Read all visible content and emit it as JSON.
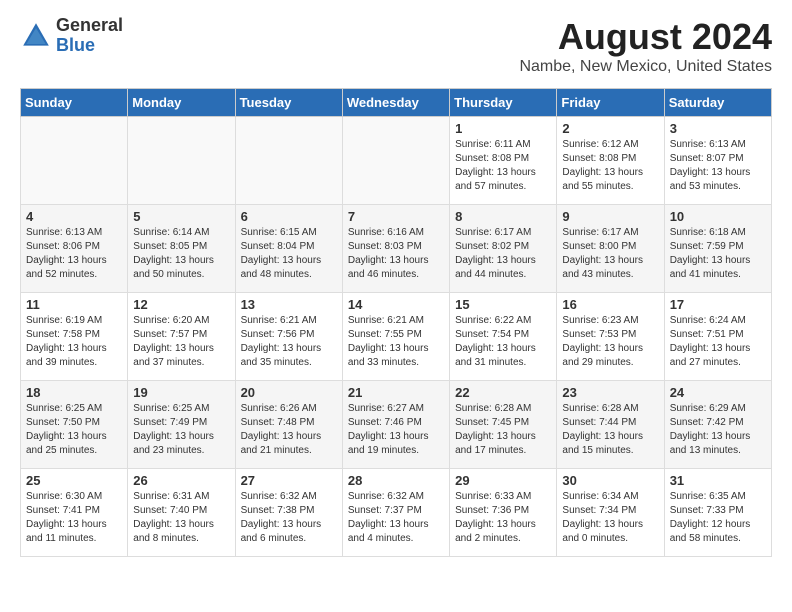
{
  "header": {
    "logo": {
      "general": "General",
      "blue": "Blue"
    },
    "title": "August 2024",
    "subtitle": "Nambe, New Mexico, United States"
  },
  "calendar": {
    "weekdays": [
      "Sunday",
      "Monday",
      "Tuesday",
      "Wednesday",
      "Thursday",
      "Friday",
      "Saturday"
    ],
    "weeks": [
      [
        {
          "day": "",
          "info": ""
        },
        {
          "day": "",
          "info": ""
        },
        {
          "day": "",
          "info": ""
        },
        {
          "day": "",
          "info": ""
        },
        {
          "day": "1",
          "info": "Sunrise: 6:11 AM\nSunset: 8:08 PM\nDaylight: 13 hours\nand 57 minutes."
        },
        {
          "day": "2",
          "info": "Sunrise: 6:12 AM\nSunset: 8:08 PM\nDaylight: 13 hours\nand 55 minutes."
        },
        {
          "day": "3",
          "info": "Sunrise: 6:13 AM\nSunset: 8:07 PM\nDaylight: 13 hours\nand 53 minutes."
        }
      ],
      [
        {
          "day": "4",
          "info": "Sunrise: 6:13 AM\nSunset: 8:06 PM\nDaylight: 13 hours\nand 52 minutes."
        },
        {
          "day": "5",
          "info": "Sunrise: 6:14 AM\nSunset: 8:05 PM\nDaylight: 13 hours\nand 50 minutes."
        },
        {
          "day": "6",
          "info": "Sunrise: 6:15 AM\nSunset: 8:04 PM\nDaylight: 13 hours\nand 48 minutes."
        },
        {
          "day": "7",
          "info": "Sunrise: 6:16 AM\nSunset: 8:03 PM\nDaylight: 13 hours\nand 46 minutes."
        },
        {
          "day": "8",
          "info": "Sunrise: 6:17 AM\nSunset: 8:02 PM\nDaylight: 13 hours\nand 44 minutes."
        },
        {
          "day": "9",
          "info": "Sunrise: 6:17 AM\nSunset: 8:00 PM\nDaylight: 13 hours\nand 43 minutes."
        },
        {
          "day": "10",
          "info": "Sunrise: 6:18 AM\nSunset: 7:59 PM\nDaylight: 13 hours\nand 41 minutes."
        }
      ],
      [
        {
          "day": "11",
          "info": "Sunrise: 6:19 AM\nSunset: 7:58 PM\nDaylight: 13 hours\nand 39 minutes."
        },
        {
          "day": "12",
          "info": "Sunrise: 6:20 AM\nSunset: 7:57 PM\nDaylight: 13 hours\nand 37 minutes."
        },
        {
          "day": "13",
          "info": "Sunrise: 6:21 AM\nSunset: 7:56 PM\nDaylight: 13 hours\nand 35 minutes."
        },
        {
          "day": "14",
          "info": "Sunrise: 6:21 AM\nSunset: 7:55 PM\nDaylight: 13 hours\nand 33 minutes."
        },
        {
          "day": "15",
          "info": "Sunrise: 6:22 AM\nSunset: 7:54 PM\nDaylight: 13 hours\nand 31 minutes."
        },
        {
          "day": "16",
          "info": "Sunrise: 6:23 AM\nSunset: 7:53 PM\nDaylight: 13 hours\nand 29 minutes."
        },
        {
          "day": "17",
          "info": "Sunrise: 6:24 AM\nSunset: 7:51 PM\nDaylight: 13 hours\nand 27 minutes."
        }
      ],
      [
        {
          "day": "18",
          "info": "Sunrise: 6:25 AM\nSunset: 7:50 PM\nDaylight: 13 hours\nand 25 minutes."
        },
        {
          "day": "19",
          "info": "Sunrise: 6:25 AM\nSunset: 7:49 PM\nDaylight: 13 hours\nand 23 minutes."
        },
        {
          "day": "20",
          "info": "Sunrise: 6:26 AM\nSunset: 7:48 PM\nDaylight: 13 hours\nand 21 minutes."
        },
        {
          "day": "21",
          "info": "Sunrise: 6:27 AM\nSunset: 7:46 PM\nDaylight: 13 hours\nand 19 minutes."
        },
        {
          "day": "22",
          "info": "Sunrise: 6:28 AM\nSunset: 7:45 PM\nDaylight: 13 hours\nand 17 minutes."
        },
        {
          "day": "23",
          "info": "Sunrise: 6:28 AM\nSunset: 7:44 PM\nDaylight: 13 hours\nand 15 minutes."
        },
        {
          "day": "24",
          "info": "Sunrise: 6:29 AM\nSunset: 7:42 PM\nDaylight: 13 hours\nand 13 minutes."
        }
      ],
      [
        {
          "day": "25",
          "info": "Sunrise: 6:30 AM\nSunset: 7:41 PM\nDaylight: 13 hours\nand 11 minutes."
        },
        {
          "day": "26",
          "info": "Sunrise: 6:31 AM\nSunset: 7:40 PM\nDaylight: 13 hours\nand 8 minutes."
        },
        {
          "day": "27",
          "info": "Sunrise: 6:32 AM\nSunset: 7:38 PM\nDaylight: 13 hours\nand 6 minutes."
        },
        {
          "day": "28",
          "info": "Sunrise: 6:32 AM\nSunset: 7:37 PM\nDaylight: 13 hours\nand 4 minutes."
        },
        {
          "day": "29",
          "info": "Sunrise: 6:33 AM\nSunset: 7:36 PM\nDaylight: 13 hours\nand 2 minutes."
        },
        {
          "day": "30",
          "info": "Sunrise: 6:34 AM\nSunset: 7:34 PM\nDaylight: 13 hours\nand 0 minutes."
        },
        {
          "day": "31",
          "info": "Sunrise: 6:35 AM\nSunset: 7:33 PM\nDaylight: 12 hours\nand 58 minutes."
        }
      ]
    ]
  }
}
